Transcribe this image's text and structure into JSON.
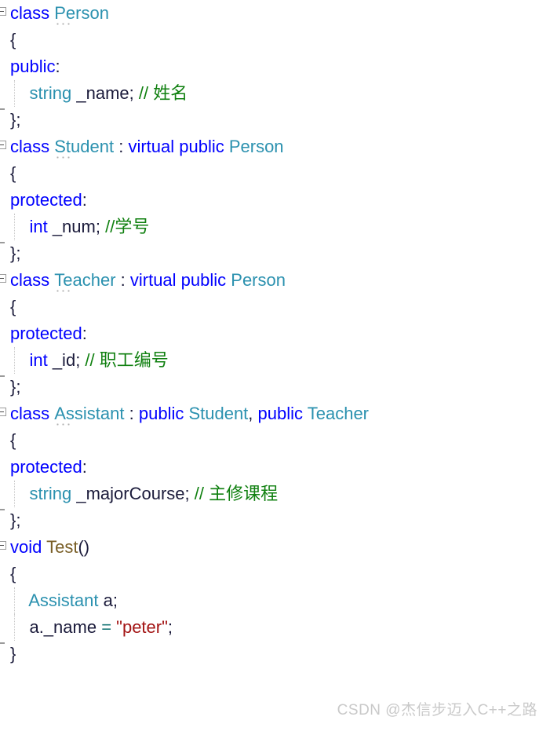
{
  "editor": {
    "language": "C++",
    "background_color": "#ffffff",
    "syntax_colors": {
      "keyword": "#0000ff",
      "type": "#2b91af",
      "function": "#795e26",
      "comment": "#108010",
      "string": "#a31515",
      "identifier": "#1a1a3a",
      "operator": "#1d7a7a",
      "indent_guide": "#c8c8c8",
      "fold_marker": "#9a9a9a"
    },
    "lines": [
      {
        "n": 1,
        "fold": "open",
        "tokens": [
          {
            "t": "class ",
            "c": "kw"
          },
          {
            "t": "Person",
            "c": "typ",
            "dots": true
          }
        ]
      },
      {
        "n": 2,
        "fold": "none",
        "tokens": [
          {
            "t": "{",
            "c": "op"
          }
        ]
      },
      {
        "n": 3,
        "fold": "none",
        "tokens": [
          {
            "t": "public",
            "c": "kw"
          },
          {
            "t": ":",
            "c": "op"
          }
        ]
      },
      {
        "n": 4,
        "fold": "none",
        "guide": true,
        "tokens": [
          {
            "t": "    ",
            "c": "op"
          },
          {
            "t": "string",
            "c": "typ"
          },
          {
            "t": " _name",
            "c": "id"
          },
          {
            "t": "; ",
            "c": "op"
          },
          {
            "t": "// 姓名",
            "c": "cmt"
          }
        ]
      },
      {
        "n": 5,
        "fold": "end",
        "tokens": [
          {
            "t": "};",
            "c": "op"
          }
        ]
      },
      {
        "n": 6,
        "fold": "open",
        "tokens": [
          {
            "t": "class ",
            "c": "kw"
          },
          {
            "t": "Student",
            "c": "typ",
            "dots": true
          },
          {
            "t": " : ",
            "c": "op"
          },
          {
            "t": "virtual public ",
            "c": "kw"
          },
          {
            "t": "Person",
            "c": "typ"
          }
        ]
      },
      {
        "n": 7,
        "fold": "none",
        "tokens": [
          {
            "t": "{",
            "c": "op"
          }
        ]
      },
      {
        "n": 8,
        "fold": "none",
        "tokens": [
          {
            "t": "protected",
            "c": "kw"
          },
          {
            "t": ":",
            "c": "op"
          }
        ]
      },
      {
        "n": 9,
        "fold": "none",
        "guide": true,
        "tokens": [
          {
            "t": "    ",
            "c": "op"
          },
          {
            "t": "int",
            "c": "kw"
          },
          {
            "t": " _num",
            "c": "id"
          },
          {
            "t": "; ",
            "c": "op"
          },
          {
            "t": "//学号",
            "c": "cmt"
          }
        ]
      },
      {
        "n": 10,
        "fold": "end",
        "tokens": [
          {
            "t": "};",
            "c": "op"
          }
        ]
      },
      {
        "n": 11,
        "fold": "open",
        "tokens": [
          {
            "t": "class ",
            "c": "kw"
          },
          {
            "t": "Teacher",
            "c": "typ",
            "dots": true
          },
          {
            "t": " : ",
            "c": "op"
          },
          {
            "t": "virtual public ",
            "c": "kw"
          },
          {
            "t": "Person",
            "c": "typ"
          }
        ]
      },
      {
        "n": 12,
        "fold": "none",
        "tokens": [
          {
            "t": "{",
            "c": "op"
          }
        ]
      },
      {
        "n": 13,
        "fold": "none",
        "tokens": [
          {
            "t": "protected",
            "c": "kw"
          },
          {
            "t": ":",
            "c": "op"
          }
        ]
      },
      {
        "n": 14,
        "fold": "none",
        "guide": true,
        "tokens": [
          {
            "t": "    ",
            "c": "op"
          },
          {
            "t": "int",
            "c": "kw"
          },
          {
            "t": " _id",
            "c": "id"
          },
          {
            "t": "; ",
            "c": "op"
          },
          {
            "t": "// 职工编号",
            "c": "cmt"
          }
        ]
      },
      {
        "n": 15,
        "fold": "end",
        "tokens": [
          {
            "t": "};",
            "c": "op"
          }
        ]
      },
      {
        "n": 16,
        "fold": "open",
        "tokens": [
          {
            "t": "class ",
            "c": "kw"
          },
          {
            "t": "Assistant",
            "c": "typ",
            "dots": true
          },
          {
            "t": " : ",
            "c": "op"
          },
          {
            "t": "public ",
            "c": "kw"
          },
          {
            "t": "Student",
            "c": "typ"
          },
          {
            "t": ", ",
            "c": "op"
          },
          {
            "t": "public ",
            "c": "kw"
          },
          {
            "t": "Teacher",
            "c": "typ"
          }
        ]
      },
      {
        "n": 17,
        "fold": "none",
        "tokens": [
          {
            "t": "{",
            "c": "op"
          }
        ]
      },
      {
        "n": 18,
        "fold": "none",
        "tokens": [
          {
            "t": "protected",
            "c": "kw"
          },
          {
            "t": ":",
            "c": "op"
          }
        ]
      },
      {
        "n": 19,
        "fold": "none",
        "guide": true,
        "tokens": [
          {
            "t": "    ",
            "c": "op"
          },
          {
            "t": "string",
            "c": "typ"
          },
          {
            "t": " _majorCourse",
            "c": "id"
          },
          {
            "t": "; ",
            "c": "op"
          },
          {
            "t": "// 主修课程",
            "c": "cmt"
          }
        ]
      },
      {
        "n": 20,
        "fold": "end",
        "tokens": [
          {
            "t": "};",
            "c": "op"
          }
        ]
      },
      {
        "n": 21,
        "fold": "open",
        "tokens": [
          {
            "t": "void ",
            "c": "kw"
          },
          {
            "t": "Test",
            "c": "fn"
          },
          {
            "t": "()",
            "c": "op"
          }
        ]
      },
      {
        "n": 22,
        "fold": "none",
        "tokens": [
          {
            "t": "{",
            "c": "op"
          }
        ]
      },
      {
        "n": 23,
        "fold": "none",
        "guide": true,
        "tokens": [
          {
            "t": "    ",
            "c": "op"
          },
          {
            "t": "Assistant",
            "c": "typ"
          },
          {
            "t": " a",
            "c": "id"
          },
          {
            "t": ";",
            "c": "op"
          }
        ]
      },
      {
        "n": 24,
        "fold": "none",
        "guide": true,
        "tokens": [
          {
            "t": "    ",
            "c": "op"
          },
          {
            "t": "a._name",
            "c": "id"
          },
          {
            "t": " = ",
            "c": "eq"
          },
          {
            "t": "\"peter\"",
            "c": "str"
          },
          {
            "t": ";",
            "c": "op"
          }
        ]
      },
      {
        "n": 25,
        "fold": "end",
        "tokens": [
          {
            "t": "}",
            "c": "op"
          }
        ]
      }
    ]
  },
  "watermark": {
    "text": "CSDN @杰信步迈入C++之路",
    "color": "#c9c9c9"
  }
}
